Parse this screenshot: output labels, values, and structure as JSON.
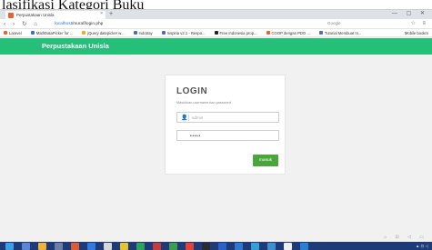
{
  "page_heading": "lasifikasi Kategori Buku",
  "browser": {
    "tab_title": "Perpustakaan Unisla",
    "tab_close": "×",
    "new_tab": "+",
    "window_controls": "— ▢ ✕",
    "nav_buttons": "‹ › ↻ ⌂",
    "url_host": "localhost",
    "url_path": "/muraf/login.php",
    "search_placeholder": "Google",
    "addr_right": "☆ ≡"
  },
  "bookmarks": [
    {
      "label": "Laravel",
      "color": "#e8622d"
    },
    {
      "label": "MathDataPicker for ...",
      "color": "#3b6fd1"
    },
    {
      "label": "jQuery datepicker w...",
      "color": "#f0a830"
    },
    {
      "label": "Indotray",
      "color": "#4a6fb3"
    },
    {
      "label": "Inspiria v2.1 - Respo...",
      "color": "#4a6fb3"
    },
    {
      "label": "Free Indonesia prop...",
      "color": "#222222"
    },
    {
      "label": "COOP dengan PDO ...",
      "color": "#e8622d"
    },
    {
      "label": "Tutorial Membuat In...",
      "color": "#4a6fb3"
    }
  ],
  "bookmarks_right": "Mobile bookm",
  "app": {
    "title": "Perpustakaan Unisla",
    "header_color": "#26bf7a"
  },
  "login": {
    "title": "LOGIN",
    "hint": "Masukkan username dan password",
    "username_placeholder": "admin",
    "password_value": "admin",
    "submit_label": "masuk",
    "button_color": "#4aa63c"
  },
  "tray": "⌂ ⊡ ◁ ▭",
  "taskbar": {
    "apps": [
      "#3aa0e8",
      "#5a86d6",
      "#f2b233",
      "#6c7ea8",
      "#e05b2f",
      "#2f7be0",
      "#d8d8d8",
      "#e8c32e",
      "#2ea35a",
      "#c93b3b",
      "#3c9e4c",
      "#e34234",
      "#2b2b2b",
      "#2b62c9",
      "#2e78d1",
      "#35a0d8",
      "#3e8ed0",
      "#f0f0f0",
      "#2a7fd4"
    ],
    "clock": "▲ ⊡ ◁"
  }
}
